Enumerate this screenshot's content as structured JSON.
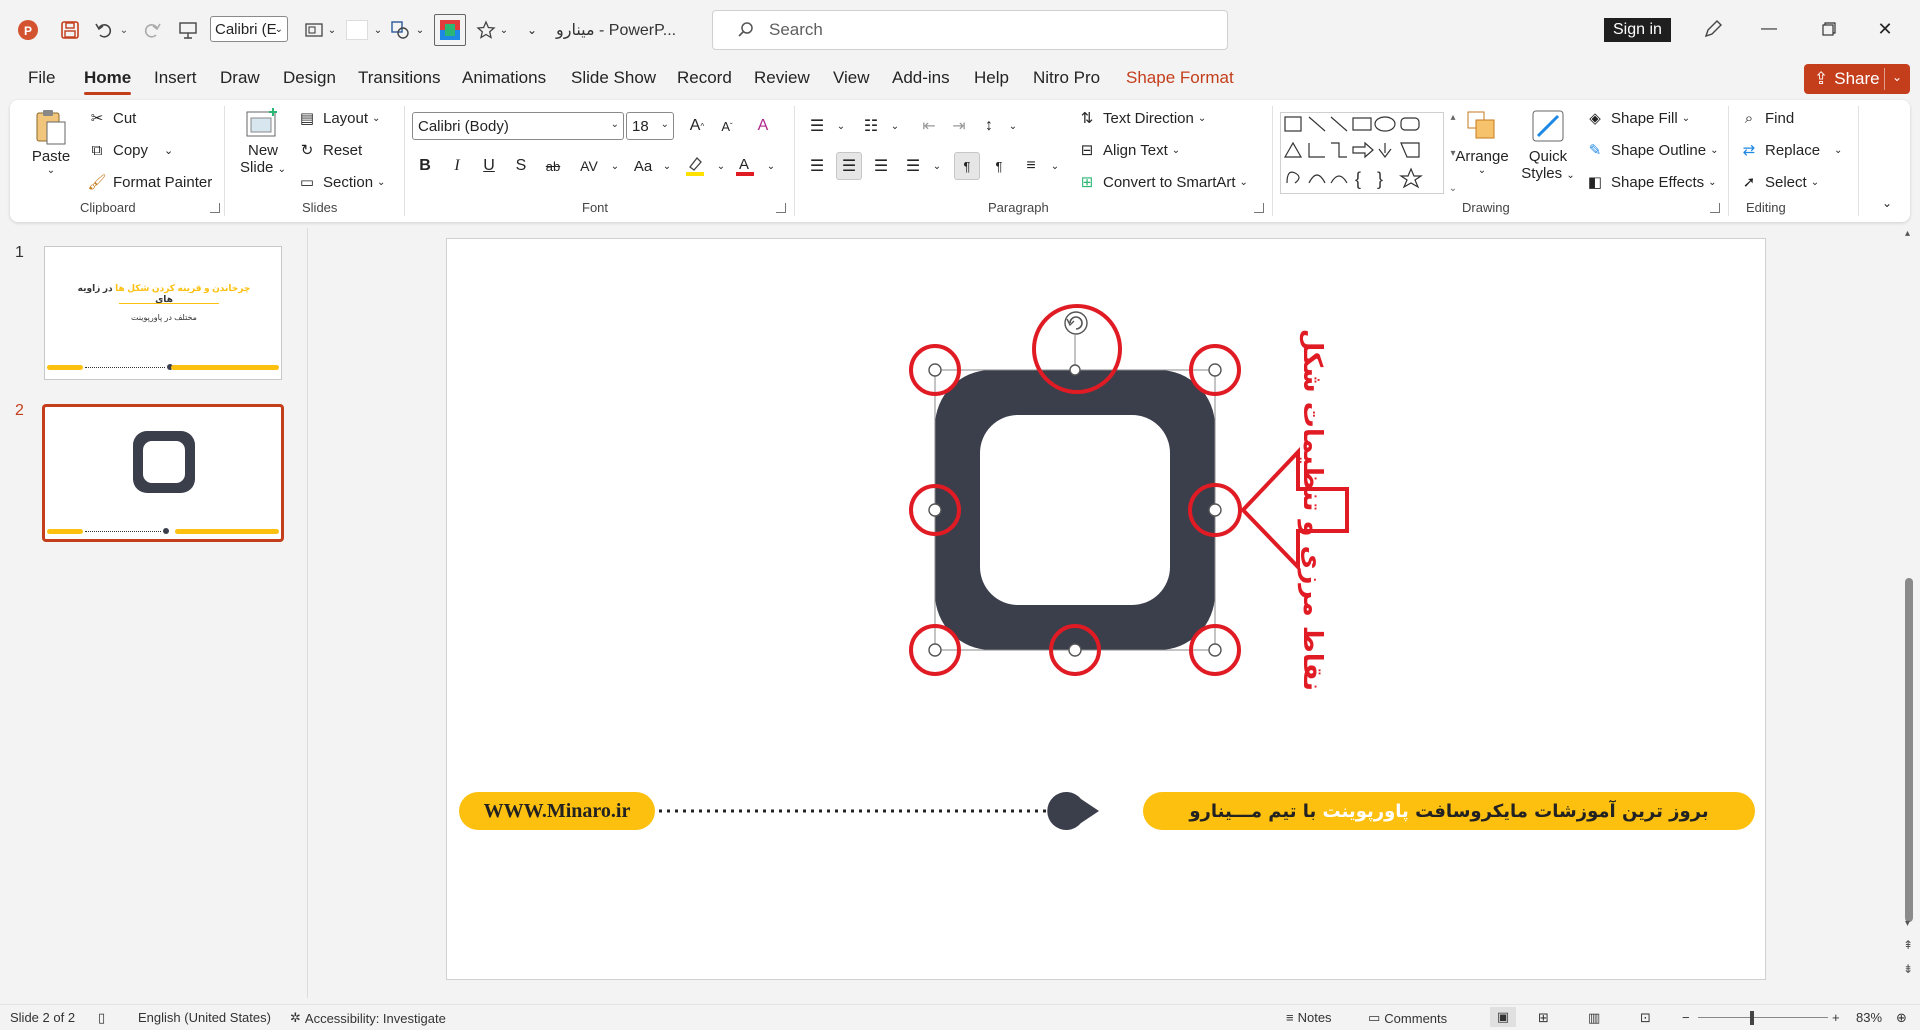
{
  "titlebar": {
    "font_combo": "Calibri (E",
    "doc_title": "مینارو  -  PowerP...",
    "search_placeholder": "Search",
    "sign_in": "Sign in"
  },
  "tabs": [
    "File",
    "Home",
    "Insert",
    "Draw",
    "Design",
    "Transitions",
    "Animations",
    "Slide Show",
    "Record",
    "Review",
    "View",
    "Add-ins",
    "Help",
    "Nitro Pro",
    "Shape Format"
  ],
  "share_label": "Share",
  "ribbon": {
    "clipboard": {
      "paste": "Paste",
      "cut": "Cut",
      "copy": "Copy",
      "format_painter": "Format Painter",
      "label": "Clipboard"
    },
    "slides": {
      "new_slide_1": "New",
      "new_slide_2": "Slide",
      "layout": "Layout",
      "reset": "Reset",
      "section": "Section",
      "label": "Slides"
    },
    "font": {
      "font_name": "Calibri (Body)",
      "font_size": "18",
      "label": "Font"
    },
    "paragraph": {
      "text_direction": "Text Direction",
      "align_text": "Align Text",
      "convert_smartart": "Convert to SmartArt",
      "label": "Paragraph"
    },
    "drawing": {
      "arrange": "Arrange",
      "quick_styles_1": "Quick",
      "quick_styles_2": "Styles",
      "shape_fill": "Shape Fill",
      "shape_outline": "Shape Outline",
      "shape_effects": "Shape Effects",
      "label": "Drawing"
    },
    "editing": {
      "find": "Find",
      "replace": "Replace",
      "select": "Select",
      "label": "Editing"
    }
  },
  "thumbnails": [
    {
      "number": "1",
      "title_highlight": "چرخاندن و قرینه کردن شکل ها",
      "title_rest": "در زاویه های",
      "subtitle": "مختلف در پاورپوینت"
    },
    {
      "number": "2"
    }
  ],
  "slide": {
    "annotation": "نقاط مرزی و تنظیمات شکل",
    "footer_url": "WWW.Minaro.ir",
    "footer_text_pre": "بروز ترین آموزشات مایکروسافت",
    "footer_text_highlight": "پاورپوینت",
    "footer_text_post": "با تیم مـــینارو"
  },
  "colors": {
    "accent": "#c43e1c",
    "shape": "#3b3f4c",
    "handle_circle": "#e01b24",
    "footer_yellow": "#fdc00f"
  },
  "statusbar": {
    "slide_info": "Slide 2 of 2",
    "language": "English (United States)",
    "accessibility": "Accessibility: Investigate",
    "notes": "Notes",
    "comments": "Comments",
    "zoom": "83%"
  }
}
